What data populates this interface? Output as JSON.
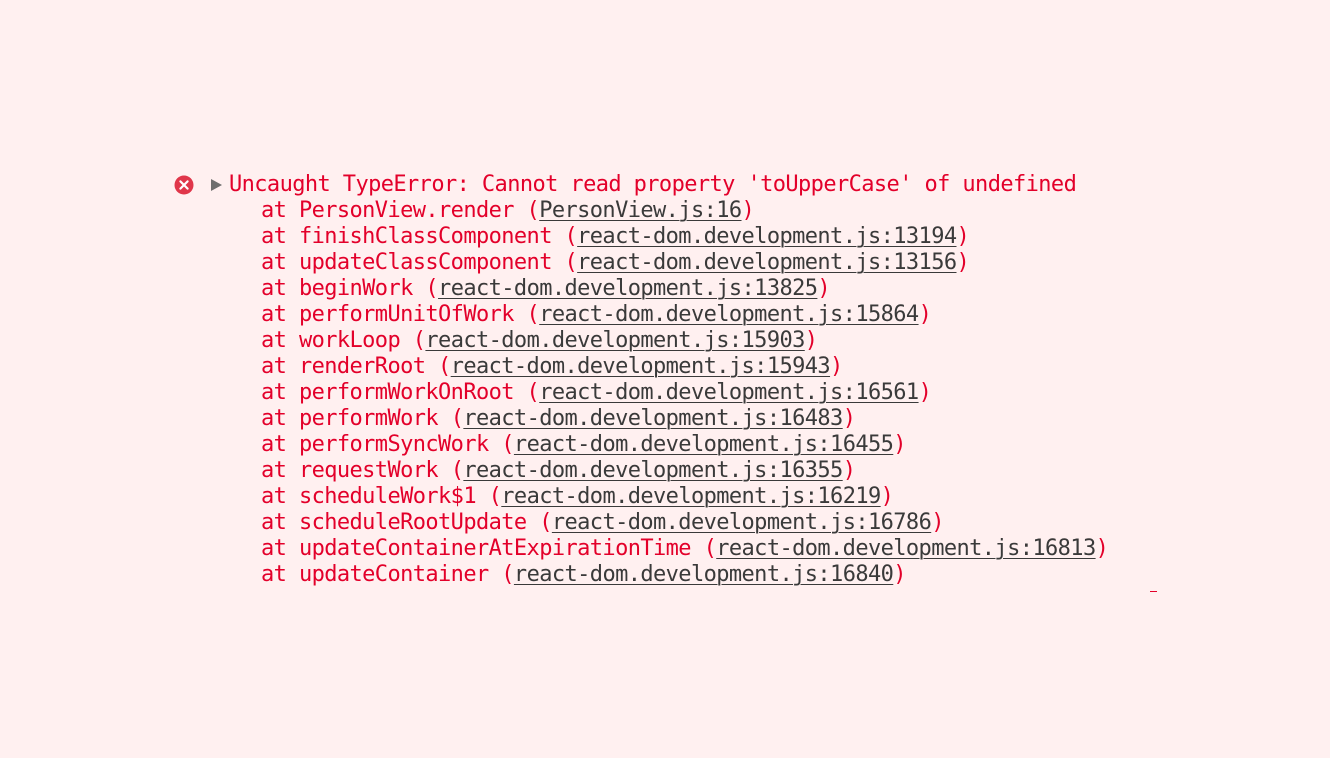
{
  "colors": {
    "background": "#fff0f0",
    "error_text": "#e3002a",
    "link_text": "#3a3a3a",
    "error_icon": "#e0364a",
    "toggle": "#6e6e6e"
  },
  "icons": {
    "status": "error-circle-x-icon",
    "toggle": "disclosure-triangle-right-icon"
  },
  "error": {
    "message": "Uncaught TypeError: Cannot read property 'toUpperCase' of undefined"
  },
  "stack": [
    {
      "fn": "PersonView.render",
      "src": "PersonView.js:16"
    },
    {
      "fn": "finishClassComponent",
      "src": "react-dom.development.js:13194"
    },
    {
      "fn": "updateClassComponent",
      "src": "react-dom.development.js:13156"
    },
    {
      "fn": "beginWork",
      "src": "react-dom.development.js:13825"
    },
    {
      "fn": "performUnitOfWork",
      "src": "react-dom.development.js:15864"
    },
    {
      "fn": "workLoop",
      "src": "react-dom.development.js:15903"
    },
    {
      "fn": "renderRoot",
      "src": "react-dom.development.js:15943"
    },
    {
      "fn": "performWorkOnRoot",
      "src": "react-dom.development.js:16561"
    },
    {
      "fn": "performWork",
      "src": "react-dom.development.js:16483"
    },
    {
      "fn": "performSyncWork",
      "src": "react-dom.development.js:16455"
    },
    {
      "fn": "requestWork",
      "src": "react-dom.development.js:16355"
    },
    {
      "fn": "scheduleWork$1",
      "src": "react-dom.development.js:16219"
    },
    {
      "fn": "scheduleRootUpdate",
      "src": "react-dom.development.js:16786"
    },
    {
      "fn": "updateContainerAtExpirationTime",
      "src": "react-dom.development.js:16813"
    },
    {
      "fn": "updateContainer",
      "src": "react-dom.development.js:16840"
    }
  ]
}
